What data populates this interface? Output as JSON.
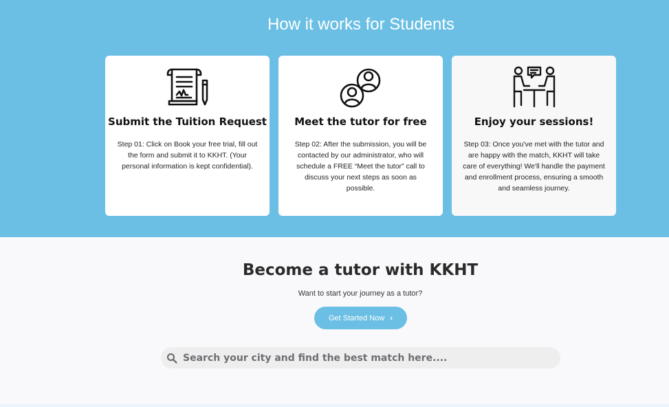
{
  "hero": {
    "title": "How it works for Students",
    "cards": [
      {
        "icon": "document-pen-icon",
        "title": "Submit the Tuition Request",
        "description": "Step 01: Click on Book your free trial, fill out the form and submit it to KKHT. (Your personal information is kept confidential)."
      },
      {
        "icon": "people-circles-icon",
        "title": "Meet the tutor for free",
        "description": "Step 02: After the submission, you will be contacted by our administrator, who will schedule a FREE “Meet the tutor” call to discuss your next steps as soon as possible."
      },
      {
        "icon": "conversation-table-icon",
        "title": "Enjoy your sessions!",
        "description": "Step 03: Once you've met with the tutor and are happy with the match, KKHT will take care of everything! We'll handle the payment and enrollment process, ensuring a smooth and seamless journey."
      }
    ]
  },
  "tutor": {
    "title": "Become a tutor with KKHT",
    "subtitle": "Want to start your journey as a tutor?",
    "button_label": "Get Started Now",
    "button_icon": "chevron-right-icon"
  },
  "search": {
    "placeholder": "Search your city and find the best match here....",
    "value": "",
    "icon": "search-icon"
  },
  "colors": {
    "accent": "#6bbfe4",
    "card_bg": "#ffffff",
    "text_dark": "#111111"
  }
}
